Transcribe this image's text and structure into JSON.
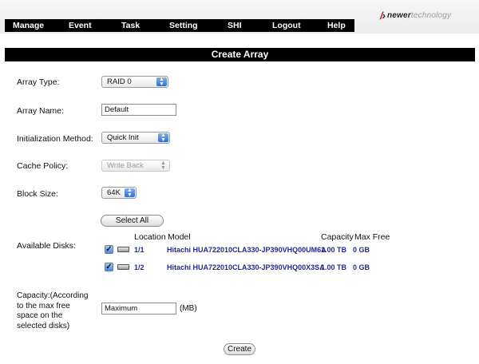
{
  "nav": {
    "items": [
      "Manage",
      "Event",
      "Task",
      "Setting",
      "SHI",
      "Logout",
      "Help"
    ]
  },
  "logo": {
    "mark": "â¿â€º",
    "brand_bold": "newer",
    "brand_light": "technology",
    "accent_color": "#c3102e"
  },
  "page_title": "Create Array",
  "form": {
    "array_type": {
      "label": "Array Type:",
      "value": "RAID 0"
    },
    "array_name": {
      "label": "Array Name:",
      "value": "Default"
    },
    "init_method": {
      "label": "Initialization Method:",
      "value": "Quick Init"
    },
    "cache_policy": {
      "label": "Cache Policy:",
      "value": "Write Back"
    },
    "block_size": {
      "label": "Block Size:",
      "value": "64K"
    },
    "select_all": "Select All",
    "available_disks_label": "Available Disks:",
    "disk_headers": {
      "location": "Location",
      "model": "Model",
      "capacity": "Capacity",
      "max_free": "Max Free"
    },
    "disks": [
      {
        "checked": true,
        "location": "1/1",
        "model": "Hitachi HUA722010CLA330-JP390VHQ00UM6A",
        "capacity": "1.00 TB",
        "max_free": "0 GB"
      },
      {
        "checked": true,
        "location": "1/2",
        "model": "Hitachi HUA722010CLA330-JP390VHQ00X3SA",
        "capacity": "1.00 TB",
        "max_free": "0 GB"
      }
    ],
    "capacity": {
      "label_lines": [
        "Capacity:(According",
        "to the max free",
        "space on the",
        "selected disks)"
      ],
      "value": "Maximum",
      "unit": "(MB)"
    },
    "create_button": "Create"
  },
  "colors": {
    "nav_bg": "#000000",
    "disk_text": "#1e2a8f",
    "select_arrow": "#2d6fd3"
  }
}
